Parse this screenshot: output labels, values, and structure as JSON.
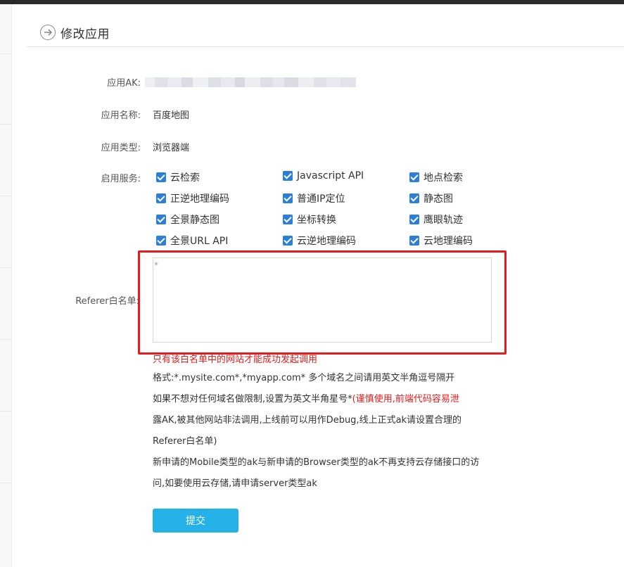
{
  "page": {
    "title": "修改应用"
  },
  "form": {
    "ak_label": "应用AK:",
    "name_label": "应用名称:",
    "name_value": "百度地图",
    "type_label": "应用类型:",
    "type_value": "浏览器端",
    "services_label": "启用服务:",
    "services": [
      [
        "云检索",
        "Javascript API",
        "地点检索"
      ],
      [
        "正逆地理编码",
        "普通IP定位",
        "静态图"
      ],
      [
        "全景静态图",
        "坐标转换",
        "鹰眼轨迹"
      ],
      [
        "全景URL API",
        "云逆地理编码",
        "云地理编码"
      ]
    ],
    "referer_label": "Referer白名单:",
    "referer_value": "*",
    "referer_note": "只有该白名单中的网站才能成功发起调用",
    "format_line": "格式:*.mysite.com*,*myapp.com* 多个域名之间请用英文半角逗号隔开",
    "wildcard_prefix": "如果不想对任何域名做限制,设置为英文半角星号*",
    "wildcard_warning_1": "(谨慎使用,前端代码容易泄",
    "wildcard_warning_2": "露AK,被其他网站非法调用,上线前可以用作Debug,线上正式ak请设置合理的",
    "wildcard_warning_3": "Referer白名单)",
    "storage_line_1": "新申请的Mobile类型的ak与新申请的Browser类型的ak不再支持云存储接口的访",
    "storage_line_2": "问,如要使用云存储,请申请server类型ak",
    "submit_label": "提交"
  },
  "colors": {
    "accent": "#2b7fd6",
    "submit": "#23b1e8",
    "warning": "#e41c1c"
  }
}
